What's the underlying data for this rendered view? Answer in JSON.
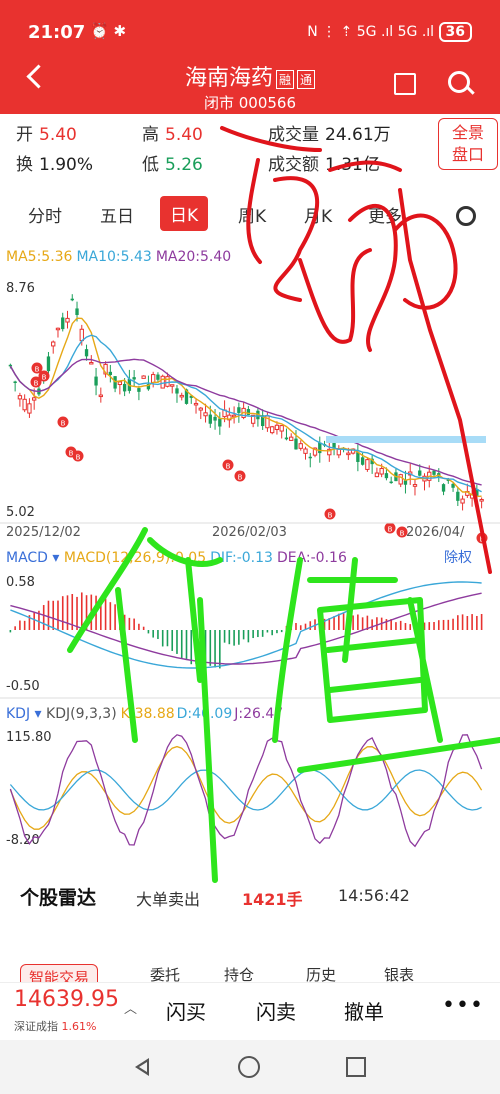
{
  "status": {
    "time": "21:07",
    "right_icons": "N ⋮ ⇡ 5G .ıl 5G .ıl",
    "battery": "36"
  },
  "header": {
    "title": "海南海药",
    "badge1": "融",
    "badge2": "通",
    "subtitle": "闭市 000566"
  },
  "quote": {
    "open_label": "开",
    "open": "5.40",
    "high_label": "高",
    "high": "5.40",
    "volume_label": "成交量",
    "volume": "24.61万",
    "turnover_label": "换",
    "turnover": "1.90%",
    "low_label": "低",
    "low": "5.26",
    "amount_label": "成交额",
    "amount": "1.31亿",
    "panorama_line1": "全景",
    "panorama_line2": "盘口"
  },
  "tabs": [
    "分时",
    "五日",
    "日K",
    "周K",
    "月K",
    "更多"
  ],
  "active_tab": "日K",
  "ma": {
    "ma5": "MA5:5.36",
    "ma10": "MA10:5.43",
    "ma20": "MA20:5.40"
  },
  "kline": {
    "max_label": "8.76",
    "min_label": "5.02",
    "dates": [
      "2025/12/02",
      "2026/02/03",
      "2026/04/"
    ],
    "buy_marker": "B"
  },
  "macd": {
    "title": "MACD",
    "params": "MACD(12,26,9):0.05",
    "dif": "DIF:-0.13",
    "dea": "DEA:-0.16",
    "adjust": "除权",
    "max": "0.58",
    "min": "-0.50"
  },
  "kdj": {
    "title": "KDJ",
    "params": "KDJ(9,3,3)",
    "k": "K:38.88",
    "d": "D:46.09",
    "j": "J:26.47",
    "max": "115.80",
    "min": "-8.20"
  },
  "radar": {
    "title": "个股雷达",
    "event": "大单卖出",
    "amount": "1421手",
    "time": "14:56:42"
  },
  "chips": [
    "智能交易",
    "委托",
    "持仓",
    "历史",
    "银表"
  ],
  "index": {
    "value": "14639.95",
    "name": "深证成指",
    "change": "1.61%"
  },
  "actions": [
    "闪买",
    "闪卖",
    "撤单"
  ],
  "more_label": "•••",
  "handwriting": {
    "red_text": "马路",
    "green_text": "价值"
  },
  "colors": {
    "accent": "#e8322f",
    "down": "#1a9e5a",
    "ma5": "#e6a817",
    "ma10": "#3aa7d8",
    "ma20": "#8e3b9e",
    "scribble_red": "#e0141b",
    "scribble_green": "#2ee51c"
  }
}
